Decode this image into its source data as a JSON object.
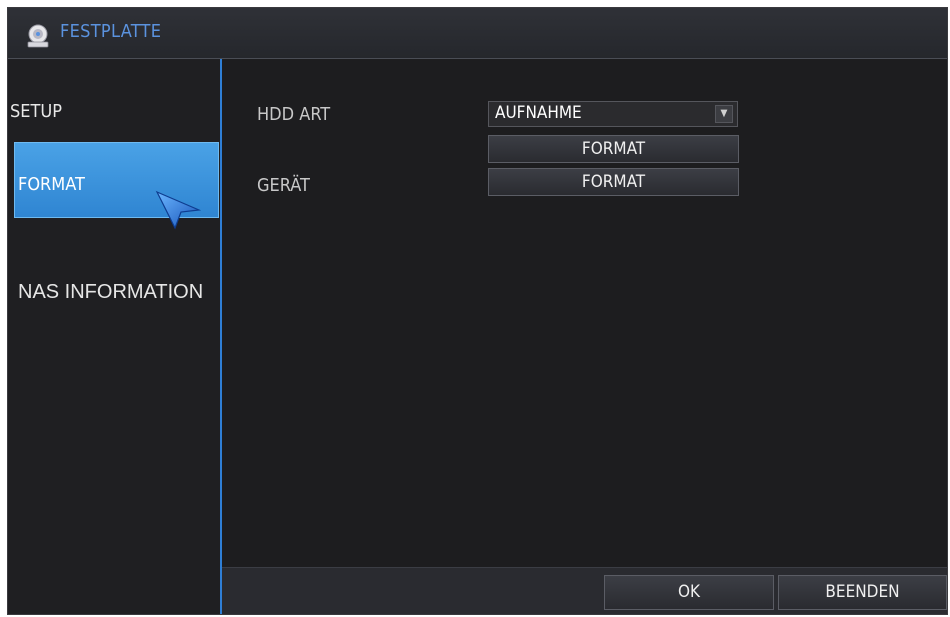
{
  "window": {
    "title": "FESTPLATTE"
  },
  "sidebar": {
    "items": [
      {
        "label": "SETUP"
      },
      {
        "label": "FORMAT"
      },
      {
        "label": "NAS INFORMATION"
      }
    ]
  },
  "main": {
    "hdd_type_label": "HDD ART",
    "hdd_type_value": "AUFNAHME",
    "format_button_1": "FORMAT",
    "device_label": "GERÄT",
    "format_button_2": "FORMAT"
  },
  "footer": {
    "ok_label": "OK",
    "exit_label": "BEENDEN"
  },
  "colors": {
    "accent": "#2f85d2",
    "title_text": "#5b93df",
    "background": "#1d1d1f"
  }
}
